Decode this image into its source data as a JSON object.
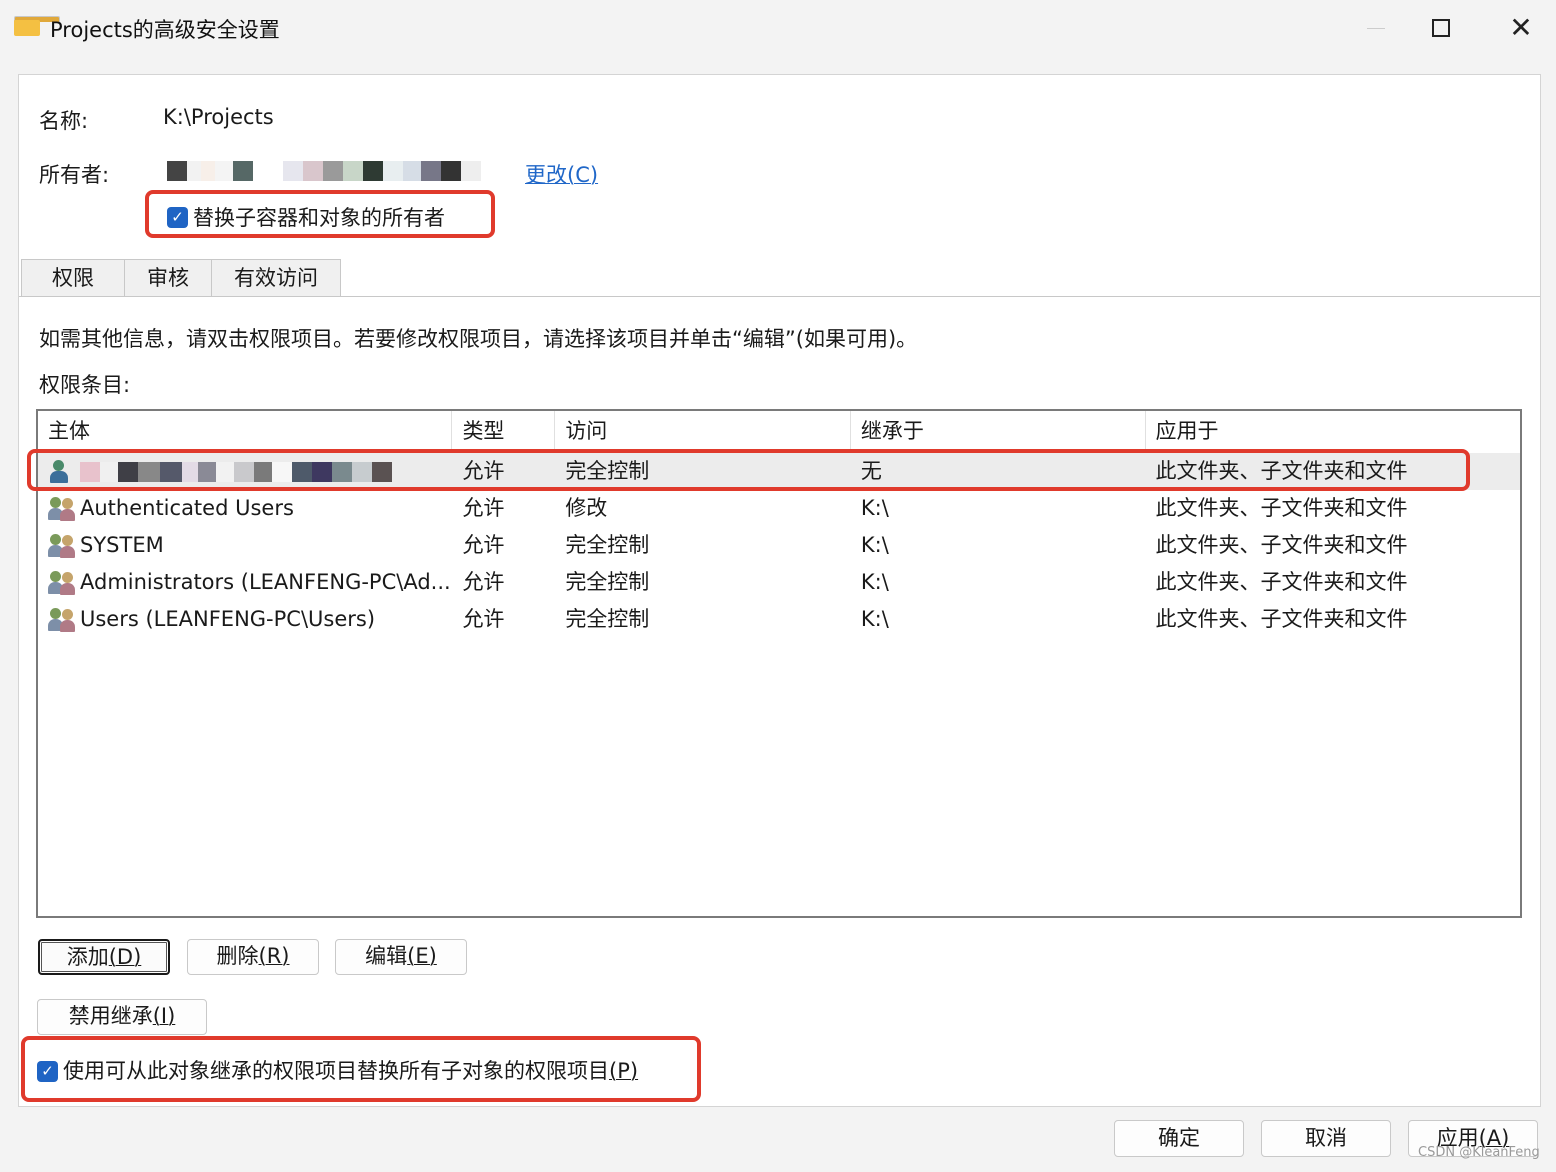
{
  "window": {
    "title": "Projects的高级安全设置"
  },
  "info": {
    "name_label": "名称:",
    "name_value": "K:\\Projects",
    "owner_label": "所有者:",
    "change_link": "更改(C)",
    "replace_owner_checkbox": {
      "label": "替换子容器和对象的所有者",
      "checked": true
    }
  },
  "tabs": [
    "权限",
    "审核",
    "有效访问"
  ],
  "permissions": {
    "info_text": "如需其他信息，请双击权限项目。若要修改权限项目，请选择该项目并单击“编辑”(如果可用)。",
    "entries_label": "权限条目:",
    "columns": [
      "主体",
      "类型",
      "访问",
      "继承于",
      "应用于"
    ],
    "rows": [
      {
        "principal": "",
        "type": "允许",
        "access": "完全控制",
        "inherited_from": "无",
        "applies_to": "此文件夹、子文件夹和文件",
        "selected": true
      },
      {
        "principal": "Authenticated Users",
        "type": "允许",
        "access": "修改",
        "inherited_from": "K:\\",
        "applies_to": "此文件夹、子文件夹和文件"
      },
      {
        "principal": "SYSTEM",
        "type": "允许",
        "access": "完全控制",
        "inherited_from": "K:\\",
        "applies_to": "此文件夹、子文件夹和文件"
      },
      {
        "principal": "Administrators (LEANFENG-PC\\Ad...",
        "type": "允许",
        "access": "完全控制",
        "inherited_from": "K:\\",
        "applies_to": "此文件夹、子文件夹和文件"
      },
      {
        "principal": "Users (LEANFENG-PC\\Users)",
        "type": "允许",
        "access": "完全控制",
        "inherited_from": "K:\\",
        "applies_to": "此文件夹、子文件夹和文件"
      }
    ]
  },
  "buttons": {
    "add": "添加",
    "add_key": "(D)",
    "remove": "删除",
    "remove_key": "(R)",
    "edit": "编辑",
    "edit_key": "(E)",
    "disable_inheritance": "禁用继承",
    "disable_inheritance_key": "(I)"
  },
  "replace_child_checkbox": {
    "label": "使用可从此对象继承的权限项目替换所有子对象的权限项目",
    "key": "(P)",
    "checked": true
  },
  "footer": {
    "ok": "确定",
    "cancel": "取消",
    "apply": "应用",
    "apply_key": "(A)"
  },
  "watermark": "CSDN @KleanFeng",
  "colors": {
    "accent": "#1f64c4",
    "link": "#2067c8",
    "highlight_box": "#e03a2c"
  }
}
